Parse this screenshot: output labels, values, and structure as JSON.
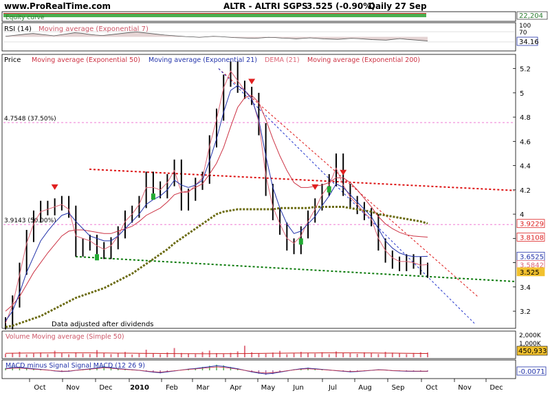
{
  "header": {
    "site": "www.ProRealTime.com",
    "title": "ALTR - ALTRI SGPS",
    "quote": "3.525 (-0.90%)",
    "period": "Daily  27 Sep"
  },
  "chart_data": [
    {
      "panel": "equity",
      "type": "line",
      "title": "Equity curve",
      "value_label": "22,204"
    },
    {
      "panel": "rsi",
      "type": "line",
      "title": "RSI (14)",
      "overlay": "Moving average (Exponential 7)",
      "yticks": [
        "100",
        "70",
        "30"
      ],
      "last_value": "34.16",
      "values": [
        52,
        55,
        58,
        61,
        63,
        60,
        57,
        54,
        58,
        62,
        66,
        64,
        60,
        57,
        55,
        58,
        61,
        64,
        67,
        69,
        66,
        63,
        60,
        57,
        55,
        53,
        51,
        50,
        48,
        50,
        52,
        51,
        49,
        47,
        46,
        45,
        44,
        46,
        48,
        47,
        45,
        44,
        42,
        44,
        46,
        44,
        42,
        41,
        40,
        42,
        44,
        43,
        41,
        39,
        38,
        37,
        40,
        43,
        40,
        38,
        36,
        34
      ],
      "ylim": [
        0,
        100
      ]
    },
    {
      "panel": "price",
      "type": "line",
      "title": "Price",
      "legend": [
        {
          "name": "Moving average (Exponential 50)",
          "color": "#cc3344"
        },
        {
          "name": "Moving average (Exponential 21)",
          "color": "#2233aa"
        },
        {
          "name": "DEMA (21)",
          "color": "#dd6677"
        },
        {
          "name": "Moving average (Exponential 200)",
          "color": "#cc3344"
        }
      ],
      "yticks": [
        3.2,
        3.4,
        3.6,
        3.8,
        4,
        4.2,
        4.4,
        4.6,
        4.8,
        5,
        5.2
      ],
      "ytick_labels": [
        "3.2",
        "3.4",
        "3.6",
        "3.8",
        "4",
        "4.2",
        "4.4",
        "4.6",
        "4.8",
        "5",
        "5.2"
      ],
      "ylim": [
        3.07,
        5.3
      ],
      "fib_levels": [
        {
          "label": "4.7548 (37.50%)",
          "value": 4.7548
        },
        {
          "label": "3.9143 (50.00%)",
          "value": 3.9143
        }
      ],
      "price_tags": [
        {
          "label": "3.9229",
          "value": 3.9229,
          "color": "#dd2222",
          "text_color": "#dd2222"
        },
        {
          "label": "3.8108",
          "value": 3.8108,
          "color": "#dd2222",
          "text_color": "#dd2222"
        },
        {
          "label": "3.6525",
          "value": 3.6525,
          "color": "#2233aa",
          "text_color": "#2233aa"
        },
        {
          "label": "3.5842",
          "value": 3.5842,
          "color": "#dd6677",
          "text_color": "#dd6677"
        },
        {
          "label": "3.525",
          "value": 3.525,
          "color": "#f2c12e",
          "text_color": "#000000",
          "filled": true
        }
      ],
      "footnote": "Data adjusted after dividends",
      "close": [
        3.1,
        3.28,
        3.55,
        3.82,
        3.98,
        4.06,
        4.04,
        4.08,
        4.1,
        4.02,
        3.7,
        3.75,
        3.78,
        3.72,
        3.68,
        3.76,
        3.85,
        3.98,
        4.02,
        4.1,
        4.3,
        4.22,
        4.18,
        4.28,
        4.4,
        4.08,
        4.16,
        4.25,
        4.3,
        4.6,
        4.82,
        5.1,
        5.21,
        5.05,
        5.0,
        4.95,
        4.7,
        4.2,
        4.0,
        3.88,
        3.75,
        3.72,
        3.85,
        3.98,
        4.08,
        4.2,
        4.28,
        4.45,
        4.2,
        4.1,
        4.05,
        4.0,
        3.95,
        3.75,
        3.65,
        3.6,
        3.58,
        3.62,
        3.6,
        3.55,
        3.525
      ],
      "ema21": [
        3.12,
        3.2,
        3.35,
        3.52,
        3.65,
        3.78,
        3.86,
        3.93,
        3.99,
        4.01,
        3.94,
        3.88,
        3.82,
        3.8,
        3.78,
        3.78,
        3.82,
        3.88,
        3.94,
        4.0,
        4.08,
        4.12,
        4.15,
        4.2,
        4.28,
        4.24,
        4.22,
        4.24,
        4.28,
        4.44,
        4.62,
        4.84,
        5.02,
        5.06,
        5.02,
        4.95,
        4.78,
        4.48,
        4.22,
        4.05,
        3.92,
        3.84,
        3.86,
        3.92,
        3.98,
        4.07,
        4.15,
        4.25,
        4.22,
        4.16,
        4.1,
        4.04,
        3.98,
        3.88,
        3.78,
        3.72,
        3.68,
        3.66,
        3.65,
        3.65,
        3.6525
      ],
      "dema21": [
        3.1,
        3.25,
        3.5,
        3.76,
        3.92,
        4.02,
        4.04,
        4.06,
        4.08,
        4.04,
        3.82,
        3.8,
        3.78,
        3.74,
        3.71,
        3.74,
        3.82,
        3.94,
        4.0,
        4.08,
        4.22,
        4.22,
        4.2,
        4.26,
        4.36,
        4.18,
        4.18,
        4.24,
        4.3,
        4.56,
        4.78,
        5.04,
        5.18,
        5.1,
        5.02,
        4.96,
        4.76,
        4.32,
        4.06,
        3.92,
        3.8,
        3.76,
        3.82,
        3.94,
        4.04,
        4.16,
        4.24,
        4.38,
        4.24,
        4.14,
        4.08,
        4.01,
        3.96,
        3.8,
        3.7,
        3.64,
        3.61,
        3.61,
        3.6,
        3.58,
        3.5842
      ],
      "ema50": [
        3.2,
        3.25,
        3.32,
        3.42,
        3.52,
        3.6,
        3.68,
        3.75,
        3.82,
        3.86,
        3.87,
        3.87,
        3.86,
        3.85,
        3.84,
        3.84,
        3.86,
        3.88,
        3.9,
        3.94,
        3.99,
        4.02,
        4.05,
        4.1,
        4.16,
        4.18,
        4.19,
        4.22,
        4.25,
        4.33,
        4.42,
        4.55,
        4.72,
        4.88,
        4.96,
        4.98,
        4.92,
        4.78,
        4.62,
        4.48,
        4.36,
        4.26,
        4.22,
        4.22,
        4.23,
        4.24,
        4.26,
        4.3,
        4.3,
        4.26,
        4.2,
        4.13,
        4.06,
        3.98,
        3.92,
        3.88,
        3.85,
        3.83,
        3.82,
        3.815,
        3.8108
      ],
      "ema200": [
        3.07,
        3.08,
        3.1,
        3.12,
        3.14,
        3.16,
        3.19,
        3.22,
        3.25,
        3.28,
        3.31,
        3.33,
        3.35,
        3.37,
        3.39,
        3.42,
        3.45,
        3.48,
        3.51,
        3.55,
        3.59,
        3.63,
        3.67,
        3.71,
        3.76,
        3.8,
        3.84,
        3.88,
        3.92,
        3.96,
        4.0,
        4.02,
        4.03,
        4.04,
        4.04,
        4.04,
        4.04,
        4.04,
        4.04,
        4.05,
        4.05,
        4.05,
        4.05,
        4.05,
        4.06,
        4.06,
        4.06,
        4.06,
        4.06,
        4.05,
        4.04,
        4.03,
        4.02,
        4.0,
        3.99,
        3.98,
        3.97,
        3.96,
        3.95,
        3.94,
        3.9229
      ]
    },
    {
      "panel": "volume",
      "type": "bar",
      "title": "Volume Moving average (Simple 50)",
      "yticks": [
        "2,000K",
        "1,000K",
        "0K"
      ],
      "last_value": "450,933",
      "values": [
        320,
        410,
        520,
        280,
        360,
        450,
        300,
        620,
        380,
        290,
        470,
        350,
        310,
        680,
        420,
        300,
        390,
        510,
        260,
        340,
        720,
        380,
        290,
        460,
        880,
        410,
        350,
        300,
        520,
        640,
        390,
        310,
        420,
        560,
        1100,
        480,
        370,
        330,
        450,
        610,
        290,
        370,
        520,
        400,
        350,
        480,
        300,
        560,
        420,
        380,
        330,
        470,
        390,
        310,
        520,
        440,
        360,
        300,
        410,
        470,
        450
      ],
      "ylim": [
        0,
        2300
      ]
    },
    {
      "panel": "macd",
      "type": "bar",
      "title": "MACD minus Signal Signal MACD (12 26 9)",
      "last_value": "-0.0071",
      "values": [
        0.012,
        0.018,
        0.02,
        0.015,
        0.01,
        0.006,
        0.002,
        -0.004,
        -0.008,
        -0.006,
        0.0,
        0.005,
        0.01,
        0.016,
        0.022,
        0.018,
        0.012,
        0.008,
        0.004,
        0.0,
        -0.006,
        -0.012,
        -0.016,
        -0.01,
        -0.004,
        0.002,
        0.008,
        0.012,
        0.018,
        0.024,
        0.03,
        0.026,
        0.018,
        0.01,
        0.0,
        -0.01,
        -0.018,
        -0.024,
        -0.02,
        -0.012,
        -0.004,
        0.004,
        0.01,
        0.014,
        0.01,
        0.006,
        0.002,
        -0.002,
        -0.006,
        -0.01,
        -0.008,
        -0.004,
        0.0,
        0.004,
        0.002,
        -0.002,
        -0.004,
        -0.006,
        -0.007,
        -0.0071,
        -0.0071
      ],
      "ylim": [
        -0.04,
        0.04
      ]
    }
  ],
  "x_axis": {
    "labels": [
      "Oct",
      "Nov",
      "Dec",
      "2010",
      "Feb",
      "Mar",
      "Apr",
      "May",
      "Jun",
      "Jul",
      "Aug",
      "Sep",
      "Oct",
      "Nov",
      "Dec"
    ]
  }
}
